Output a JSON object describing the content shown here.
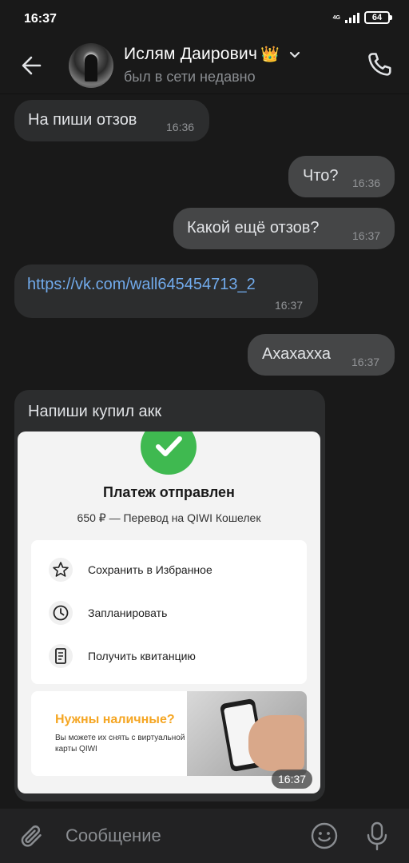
{
  "status_bar": {
    "time": "16:37",
    "network": "4G",
    "battery": "64"
  },
  "header": {
    "contact_name": "Ислям Даирович",
    "crown": "👑",
    "status": "был в сети недавно"
  },
  "messages": [
    {
      "dir": "in",
      "text": "На пиши отзов",
      "time": "16:36"
    },
    {
      "dir": "out",
      "text": "Что?",
      "time": "16:36"
    },
    {
      "dir": "out",
      "text": "Какой ещё отзов?",
      "time": "16:37"
    },
    {
      "dir": "in",
      "text": "https://vk.com/wall645454713_2",
      "time": "16:37",
      "is_link": true
    },
    {
      "dir": "out",
      "text": "Ахахахха",
      "time": "16:37"
    },
    {
      "dir": "in",
      "text": "Напиши купил акк",
      "time": "16:37",
      "has_image": true
    }
  ],
  "attachment": {
    "title": "Платеж отправлен",
    "subtitle": "650 ₽ — Перевод на QIWI Кошелек",
    "options": [
      {
        "label": "Сохранить в Избранное",
        "icon": "star-icon"
      },
      {
        "label": "Запланировать",
        "icon": "clock-icon"
      },
      {
        "label": "Получить квитанцию",
        "icon": "receipt-icon"
      }
    ],
    "promo_title": "Нужны наличные?",
    "promo_text": "Вы можете их снять с виртуальной карты QIWI",
    "time": "16:37"
  },
  "composer": {
    "placeholder": "Сообщение"
  },
  "colors": {
    "background": "#191919",
    "incoming_bubble": "#2c2d2e",
    "outgoing_bubble": "#454647",
    "link": "#71aaeb",
    "success_green": "#3fb950",
    "promo_orange": "#f5a623"
  }
}
